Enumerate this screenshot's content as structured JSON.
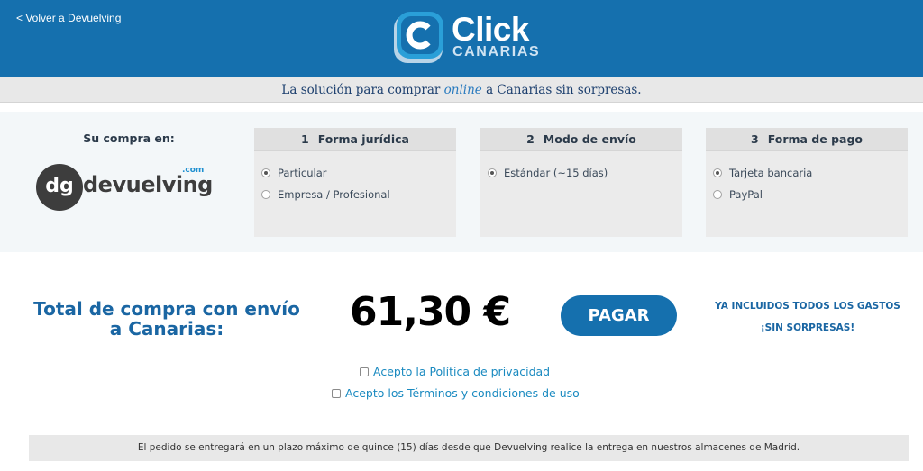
{
  "header": {
    "back_link": "< Volver a Devuelving",
    "logo_text": "Click",
    "logo_subtext": "CANARIAS",
    "brand_color": "#1570ae"
  },
  "tagline": {
    "before": "La solución para comprar",
    "emphasis": "online",
    "after": "a Canarias sin sorpresas."
  },
  "shop": {
    "label": "Su compra en:",
    "logo_mark": "dg",
    "logo_name": "devuelving",
    "logo_suffix": ".com"
  },
  "steps": [
    {
      "number": "1",
      "title": "Forma jurídica",
      "options": [
        {
          "label": "Particular",
          "checked": true
        },
        {
          "label": "Empresa / Profesional",
          "checked": false
        }
      ]
    },
    {
      "number": "2",
      "title": "Modo de envío",
      "options": [
        {
          "label": "Estándar (~15 días)",
          "checked": true
        }
      ]
    },
    {
      "number": "3",
      "title": "Forma de pago",
      "options": [
        {
          "label": "Tarjeta bancaria",
          "checked": true
        },
        {
          "label": "PayPal",
          "checked": false
        }
      ]
    }
  ],
  "total": {
    "label": "Total de compra con envío a Canarias:",
    "amount": "61,30 €",
    "pay_button": "PAGAR",
    "fees_line1": "YA INCLUIDOS TODOS LOS GASTOS",
    "fees_line2": "¡SIN SORPRESAS!"
  },
  "consents": {
    "privacy": "Acepto la Política de privacidad",
    "terms": "Acepto los Términos y condiciones de uso"
  },
  "footer_note": "El pedido se entregará en un plazo máximo de quince (15) días desde que Devuelving realice la entrega en nuestros almacenes de Madrid."
}
